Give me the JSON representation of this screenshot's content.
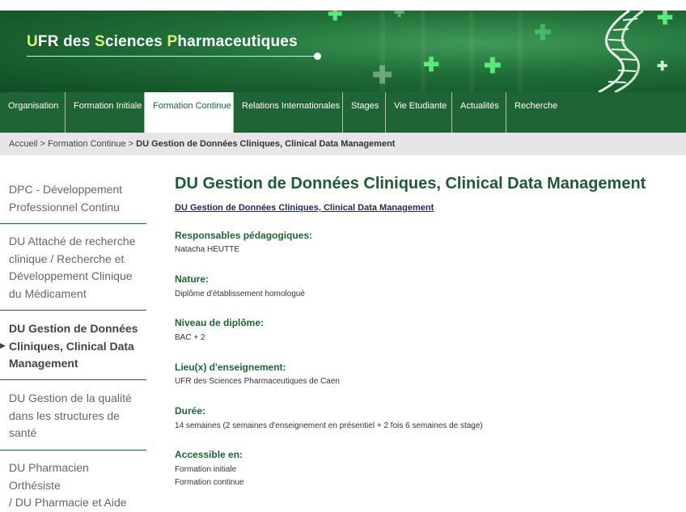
{
  "banner": {
    "title_parts": [
      "U",
      "FR des ",
      "S",
      "ciences ",
      "P",
      "harmaceutiques"
    ]
  },
  "nav": {
    "items": [
      {
        "label": "Organisation"
      },
      {
        "label": "Formation Initiale"
      },
      {
        "label": "Formation Continue",
        "active": true
      },
      {
        "label": "Relations Internationales"
      },
      {
        "label": "Stages"
      },
      {
        "label": "Vie Etudiante"
      },
      {
        "label": "Actualités"
      },
      {
        "label": "Recherche"
      }
    ]
  },
  "breadcrumb": {
    "home": "Accueil",
    "sep": " > ",
    "section": "Formation Continue",
    "current": "DU Gestion de Données Cliniques, Clinical Data Management"
  },
  "sidebar": {
    "items": [
      {
        "lines": [
          "DPC - Développement",
          "Professionnel Continu"
        ]
      },
      {
        "lines": [
          "DU Attaché de recherche",
          "clinique / Recherche et",
          "Développement Clinique",
          "du Médicament"
        ]
      },
      {
        "lines": [
          "DU Gestion de Données",
          "Cliniques, Clinical Data",
          "Management"
        ],
        "active": true
      },
      {
        "lines": [
          "DU Gestion de la qualité",
          "dans les structures de",
          "santé"
        ]
      },
      {
        "lines": [
          "DU Pharmacien Orthésiste",
          "/ DU Pharmacie et Aide"
        ]
      }
    ]
  },
  "main": {
    "title": "DU Gestion de Données Cliniques, Clinical Data Management",
    "sub_link": "DU Gestion de Données Cliniques, Clinical Data Management",
    "sections": [
      {
        "label": "Responsables pédagogiques:",
        "values": [
          "Natacha HEUTTE"
        ]
      },
      {
        "label": "Nature:",
        "values": [
          "Diplôme d'établissement homologué"
        ]
      },
      {
        "label": "Niveau de diplôme:",
        "values": [
          "BAC + 2"
        ]
      },
      {
        "label": "Lieu(x) d'enseignement:",
        "values": [
          "UFR des Sciences Pharmaceutiques de Caen"
        ]
      },
      {
        "label": "Durée:",
        "values": [
          "14 semaines (2 semaines d'enseignement en présentiel + 2 fois 6 semaines de stage)"
        ]
      },
      {
        "label": "Accessible en:",
        "values": [
          "Formation initiale",
          "Formation continue"
        ]
      }
    ]
  },
  "colors": {
    "brand_green": "#1e6434",
    "title_green": "#1e5a34",
    "breadcrumb_bg": "#e6e6e6",
    "highlight_letter": "#d8f07a"
  },
  "icons": [
    "plus-cross-icon",
    "dna-helix-icon",
    "arrow-right-icon"
  ]
}
